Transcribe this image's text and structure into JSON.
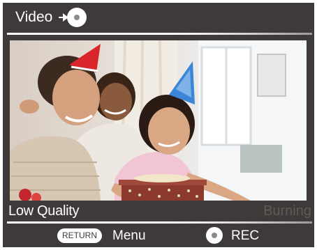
{
  "header": {
    "title": "Video",
    "title_icon": "disc-icon"
  },
  "preview": {
    "subject": "photo-thumbnail"
  },
  "status": {
    "quality": "Low Quality",
    "burning": "Burning"
  },
  "footer": {
    "return_label": "RETURN",
    "menu_label": "Menu",
    "rec_icon": "disc-icon",
    "rec_label": "REC"
  },
  "colors": {
    "background": "#3e3a39",
    "text": "#ffffff",
    "dim_text": "#5e5a58"
  }
}
